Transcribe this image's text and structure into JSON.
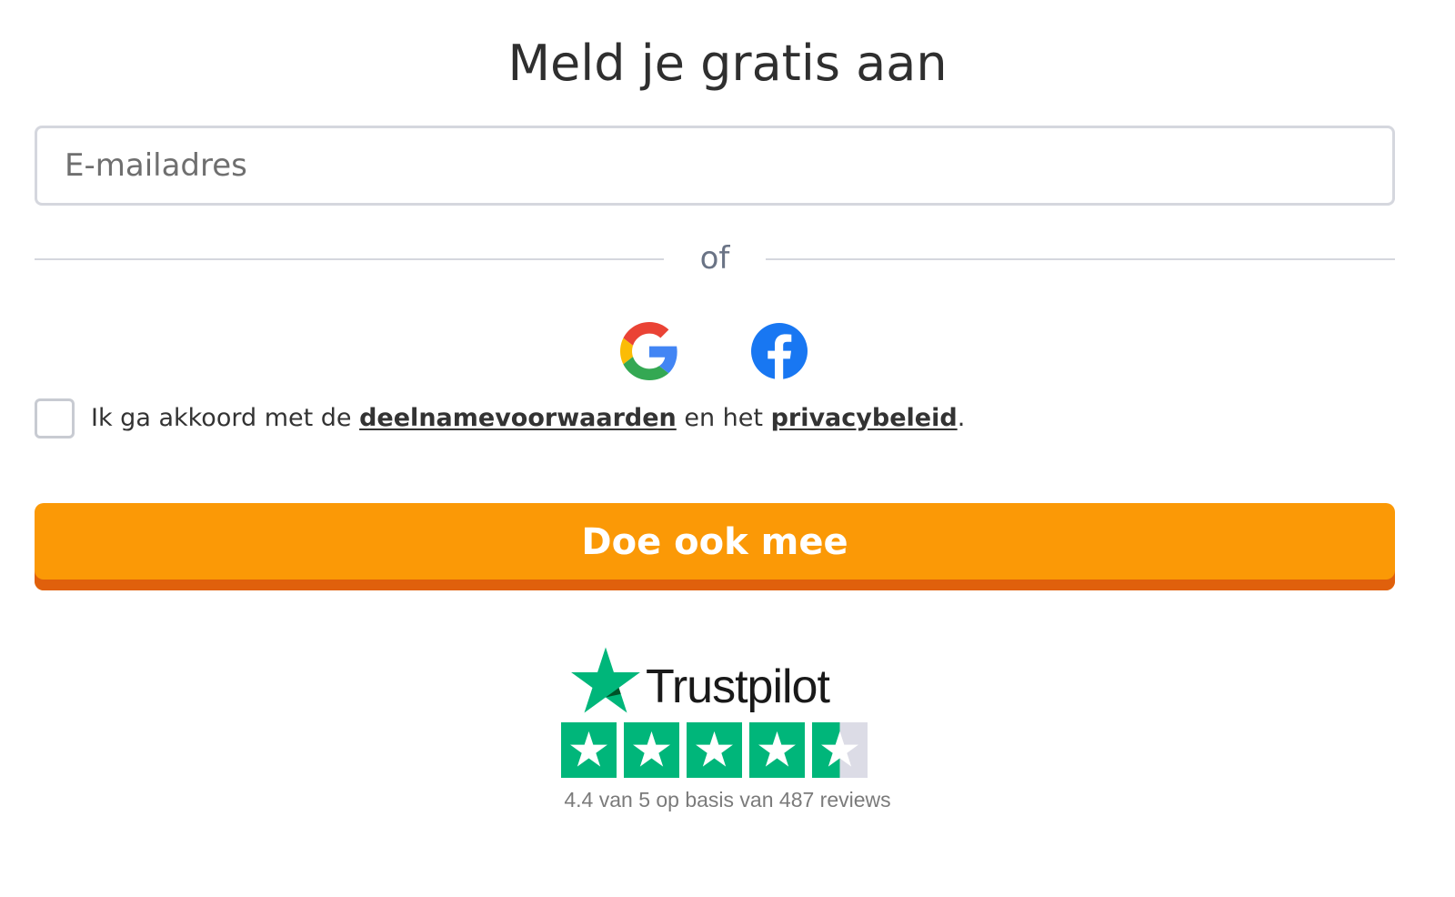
{
  "form": {
    "title": "Meld je gratis aan",
    "email_placeholder": "E-mailadres",
    "divider_text": "of",
    "social": {
      "google_icon": "google-logo",
      "facebook_icon": "facebook-logo"
    },
    "consent": {
      "prefix": "Ik ga akkoord met de ",
      "terms_link": "deelnamevoorwaarden",
      "middle": " en het ",
      "privacy_link": "privacybeleid",
      "suffix": ".",
      "checked": false
    },
    "submit_label": "Doe ook mee",
    "colors": {
      "cta": "#fb9906",
      "cta_shadow": "#e0600c",
      "trustpilot_green": "#00b67a",
      "facebook_blue": "#1877f2"
    }
  },
  "trustpilot": {
    "brand": "Trustpilot",
    "rating": 4.4,
    "max_rating": 5,
    "stars_filled_fraction": 0.88,
    "rating_text": "4.4 van 5 op basis van 487 reviews"
  }
}
